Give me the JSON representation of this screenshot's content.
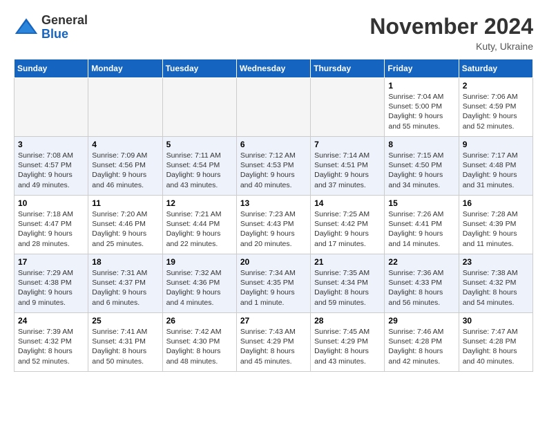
{
  "app": {
    "name_general": "General",
    "name_blue": "Blue"
  },
  "title": "November 2024",
  "location": "Kuty, Ukraine",
  "days_of_week": [
    "Sunday",
    "Monday",
    "Tuesday",
    "Wednesday",
    "Thursday",
    "Friday",
    "Saturday"
  ],
  "weeks": [
    [
      {
        "day": "",
        "empty": true
      },
      {
        "day": "",
        "empty": true
      },
      {
        "day": "",
        "empty": true
      },
      {
        "day": "",
        "empty": true
      },
      {
        "day": "",
        "empty": true
      },
      {
        "day": "1",
        "sunrise": "7:04 AM",
        "sunset": "5:00 PM",
        "daylight": "9 hours and 55 minutes."
      },
      {
        "day": "2",
        "sunrise": "7:06 AM",
        "sunset": "4:59 PM",
        "daylight": "9 hours and 52 minutes."
      }
    ],
    [
      {
        "day": "3",
        "sunrise": "7:08 AM",
        "sunset": "4:57 PM",
        "daylight": "9 hours and 49 minutes."
      },
      {
        "day": "4",
        "sunrise": "7:09 AM",
        "sunset": "4:56 PM",
        "daylight": "9 hours and 46 minutes."
      },
      {
        "day": "5",
        "sunrise": "7:11 AM",
        "sunset": "4:54 PM",
        "daylight": "9 hours and 43 minutes."
      },
      {
        "day": "6",
        "sunrise": "7:12 AM",
        "sunset": "4:53 PM",
        "daylight": "9 hours and 40 minutes."
      },
      {
        "day": "7",
        "sunrise": "7:14 AM",
        "sunset": "4:51 PM",
        "daylight": "9 hours and 37 minutes."
      },
      {
        "day": "8",
        "sunrise": "7:15 AM",
        "sunset": "4:50 PM",
        "daylight": "9 hours and 34 minutes."
      },
      {
        "day": "9",
        "sunrise": "7:17 AM",
        "sunset": "4:48 PM",
        "daylight": "9 hours and 31 minutes."
      }
    ],
    [
      {
        "day": "10",
        "sunrise": "7:18 AM",
        "sunset": "4:47 PM",
        "daylight": "9 hours and 28 minutes."
      },
      {
        "day": "11",
        "sunrise": "7:20 AM",
        "sunset": "4:46 PM",
        "daylight": "9 hours and 25 minutes."
      },
      {
        "day": "12",
        "sunrise": "7:21 AM",
        "sunset": "4:44 PM",
        "daylight": "9 hours and 22 minutes."
      },
      {
        "day": "13",
        "sunrise": "7:23 AM",
        "sunset": "4:43 PM",
        "daylight": "9 hours and 20 minutes."
      },
      {
        "day": "14",
        "sunrise": "7:25 AM",
        "sunset": "4:42 PM",
        "daylight": "9 hours and 17 minutes."
      },
      {
        "day": "15",
        "sunrise": "7:26 AM",
        "sunset": "4:41 PM",
        "daylight": "9 hours and 14 minutes."
      },
      {
        "day": "16",
        "sunrise": "7:28 AM",
        "sunset": "4:39 PM",
        "daylight": "9 hours and 11 minutes."
      }
    ],
    [
      {
        "day": "17",
        "sunrise": "7:29 AM",
        "sunset": "4:38 PM",
        "daylight": "9 hours and 9 minutes."
      },
      {
        "day": "18",
        "sunrise": "7:31 AM",
        "sunset": "4:37 PM",
        "daylight": "9 hours and 6 minutes."
      },
      {
        "day": "19",
        "sunrise": "7:32 AM",
        "sunset": "4:36 PM",
        "daylight": "9 hours and 4 minutes."
      },
      {
        "day": "20",
        "sunrise": "7:34 AM",
        "sunset": "4:35 PM",
        "daylight": "9 hours and 1 minute."
      },
      {
        "day": "21",
        "sunrise": "7:35 AM",
        "sunset": "4:34 PM",
        "daylight": "8 hours and 59 minutes."
      },
      {
        "day": "22",
        "sunrise": "7:36 AM",
        "sunset": "4:33 PM",
        "daylight": "8 hours and 56 minutes."
      },
      {
        "day": "23",
        "sunrise": "7:38 AM",
        "sunset": "4:32 PM",
        "daylight": "8 hours and 54 minutes."
      }
    ],
    [
      {
        "day": "24",
        "sunrise": "7:39 AM",
        "sunset": "4:32 PM",
        "daylight": "8 hours and 52 minutes."
      },
      {
        "day": "25",
        "sunrise": "7:41 AM",
        "sunset": "4:31 PM",
        "daylight": "8 hours and 50 minutes."
      },
      {
        "day": "26",
        "sunrise": "7:42 AM",
        "sunset": "4:30 PM",
        "daylight": "8 hours and 48 minutes."
      },
      {
        "day": "27",
        "sunrise": "7:43 AM",
        "sunset": "4:29 PM",
        "daylight": "8 hours and 45 minutes."
      },
      {
        "day": "28",
        "sunrise": "7:45 AM",
        "sunset": "4:29 PM",
        "daylight": "8 hours and 43 minutes."
      },
      {
        "day": "29",
        "sunrise": "7:46 AM",
        "sunset": "4:28 PM",
        "daylight": "8 hours and 42 minutes."
      },
      {
        "day": "30",
        "sunrise": "7:47 AM",
        "sunset": "4:28 PM",
        "daylight": "8 hours and 40 minutes."
      }
    ]
  ],
  "labels": {
    "sunrise": "Sunrise:",
    "sunset": "Sunset:",
    "daylight": "Daylight:"
  }
}
